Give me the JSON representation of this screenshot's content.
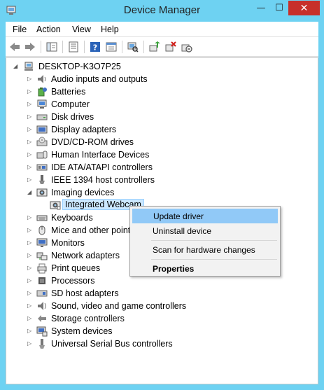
{
  "window": {
    "title": "Device Manager",
    "controls": {
      "minimize": "—",
      "maximize": "☐",
      "close": "✕"
    }
  },
  "menubar": {
    "items": [
      "File",
      "Action",
      "View",
      "Help"
    ]
  },
  "toolbar": {
    "icons": [
      "back-icon",
      "forward-icon",
      "show-hide-console-tree-icon",
      "properties-icon",
      "help-icon",
      "view-icon",
      "scan-hardware-icon",
      "update-driver-icon",
      "uninstall-device-icon",
      "disable-device-icon"
    ]
  },
  "tree": {
    "root": "DESKTOP-K3O7P25",
    "categories": [
      {
        "label": "Audio inputs and outputs",
        "icon": "speaker-icon"
      },
      {
        "label": "Batteries",
        "icon": "battery-icon"
      },
      {
        "label": "Computer",
        "icon": "computer-icon"
      },
      {
        "label": "Disk drives",
        "icon": "disk-drive-icon"
      },
      {
        "label": "Display adapters",
        "icon": "display-adapter-icon"
      },
      {
        "label": "DVD/CD-ROM drives",
        "icon": "dvd-drive-icon"
      },
      {
        "label": "Human Interface Devices",
        "icon": "hid-icon"
      },
      {
        "label": "IDE ATA/ATAPI controllers",
        "icon": "ide-controller-icon"
      },
      {
        "label": "IEEE 1394 host controllers",
        "icon": "ieee1394-icon"
      },
      {
        "label": "Imaging devices",
        "icon": "camera-icon",
        "expanded": true
      },
      {
        "label": "Keyboards",
        "icon": "keyboard-icon"
      },
      {
        "label": "Mice and other pointi",
        "icon": "mouse-icon"
      },
      {
        "label": "Monitors",
        "icon": "monitor-icon"
      },
      {
        "label": "Network adapters",
        "icon": "network-adapter-icon"
      },
      {
        "label": "Print queues",
        "icon": "printer-icon"
      },
      {
        "label": "Processors",
        "icon": "processor-icon"
      },
      {
        "label": "SD host adapters",
        "icon": "sd-card-icon"
      },
      {
        "label": "Sound, video and game controllers",
        "icon": "sound-icon"
      },
      {
        "label": "Storage controllers",
        "icon": "storage-controller-icon"
      },
      {
        "label": "System devices",
        "icon": "system-device-icon"
      },
      {
        "label": "Universal Serial Bus controllers",
        "icon": "usb-icon"
      }
    ],
    "selected_child": "Integrated Webcam"
  },
  "context_menu": {
    "items": [
      "Update driver",
      "Uninstall device",
      "Scan for hardware changes",
      "Properties"
    ],
    "highlighted": "Update driver"
  },
  "colors": {
    "title_bar": "#6ed2f2",
    "close_button": "#c7302a",
    "selection": "#cce8ff",
    "menu_highlight": "#91c9f7"
  }
}
